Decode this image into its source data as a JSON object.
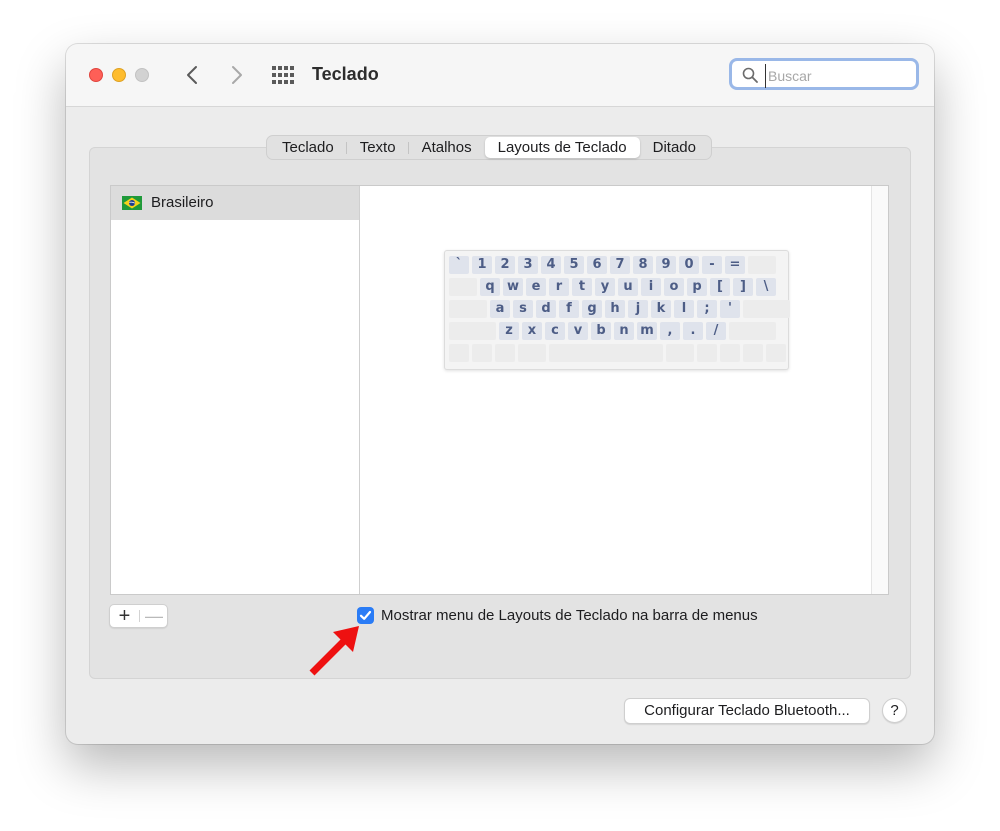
{
  "window": {
    "title": "Teclado",
    "traffic_lights": {
      "close": "#fe5f57",
      "minimize": "#febc2e",
      "zoom": "#d2d2d2"
    }
  },
  "toolbar": {
    "back_icon": "chevron-left-icon",
    "forward_icon": "chevron-right-icon",
    "grid_icon": "grid-icon"
  },
  "search": {
    "placeholder": "Buscar",
    "value": ""
  },
  "tabs": [
    {
      "label": "Teclado",
      "active": false
    },
    {
      "label": "Texto",
      "active": false
    },
    {
      "label": "Atalhos",
      "active": false
    },
    {
      "label": "Layouts de Teclado",
      "active": true
    },
    {
      "label": "Ditado",
      "active": false
    }
  ],
  "layouts_list": {
    "items": [
      {
        "label": "Brasileiro",
        "flag_icon": "brazil-flag-icon",
        "selected": true
      }
    ]
  },
  "keyboard_preview": {
    "rows": [
      [
        "`",
        "1",
        "2",
        "3",
        "4",
        "5",
        "6",
        "7",
        "8",
        "9",
        "0",
        "-",
        "="
      ],
      [
        "q",
        "w",
        "e",
        "r",
        "t",
        "y",
        "u",
        "i",
        "o",
        "p",
        "[",
        "]",
        "\\"
      ],
      [
        "a",
        "s",
        "d",
        "f",
        "g",
        "h",
        "j",
        "k",
        "l",
        ";",
        "'"
      ],
      [
        "z",
        "x",
        "c",
        "v",
        "b",
        "n",
        "m",
        ",",
        ".",
        "/"
      ]
    ]
  },
  "list_controls": {
    "add_label": "+",
    "remove_label": "—"
  },
  "show_menu_checkbox": {
    "checked": true,
    "label": "Mostrar menu de Layouts de Teclado na barra de menus"
  },
  "footer": {
    "bluetooth_button": "Configurar Teclado Bluetooth...",
    "help_button": "?"
  },
  "colors": {
    "accent": "#2a7cf6",
    "annotation_arrow": "#ee1111",
    "key_text": "#4d5d86"
  }
}
